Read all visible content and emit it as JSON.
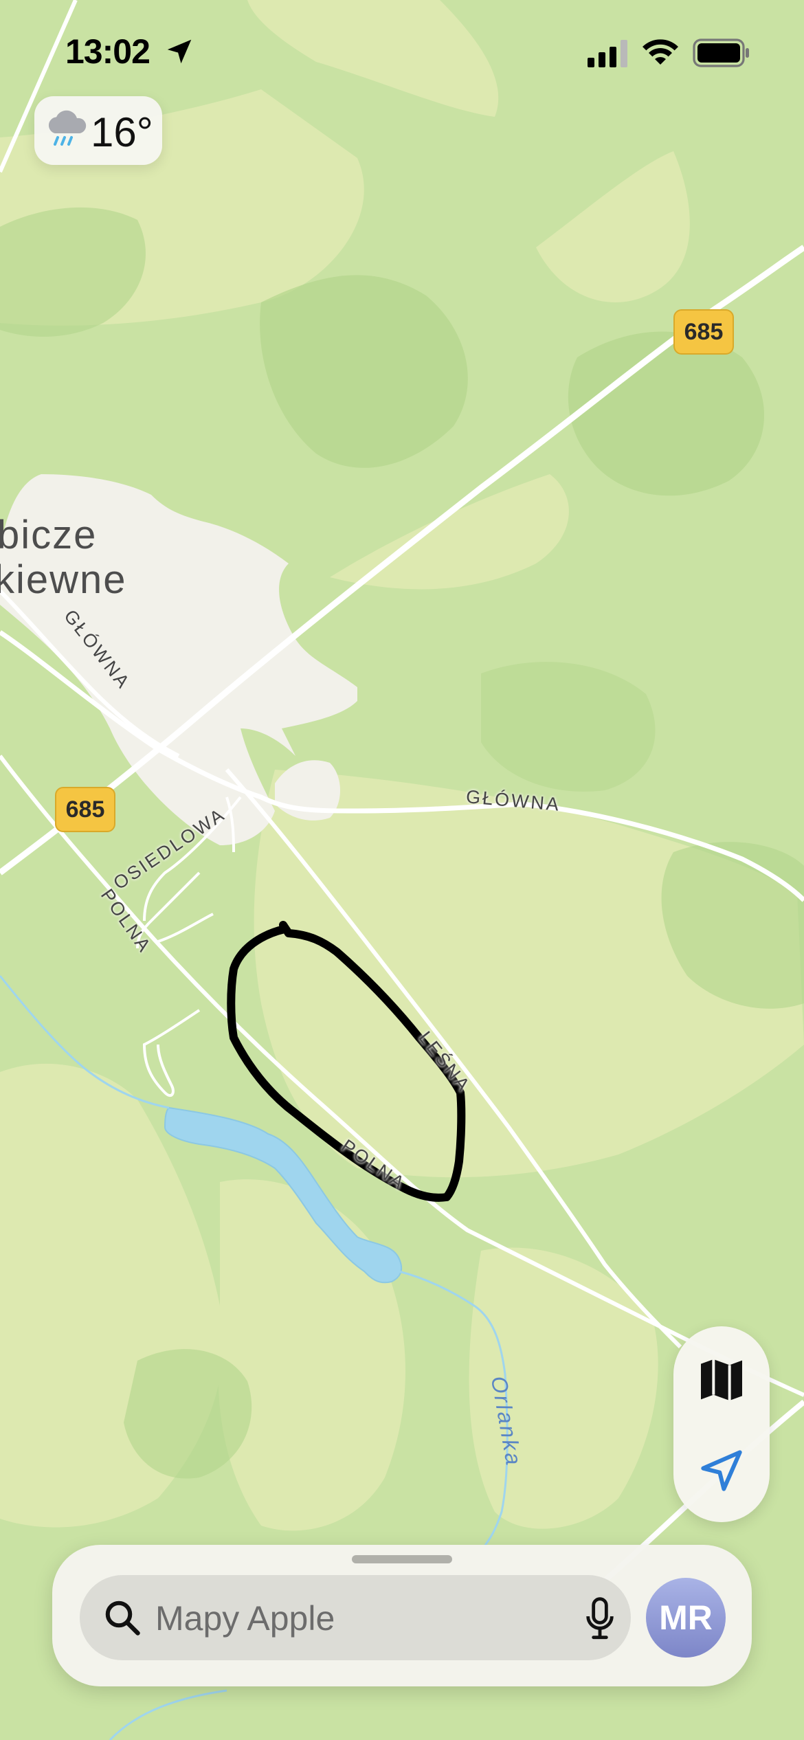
{
  "status_bar": {
    "time": "13:02",
    "location_icon": "location-arrow-icon",
    "signal_icon": "cellular-signal-icon",
    "wifi_icon": "wifi-icon",
    "battery_icon": "battery-icon"
  },
  "weather": {
    "icon": "cloud-rain-icon",
    "temperature": "16°"
  },
  "map": {
    "place_name_line1": "bicze",
    "place_name_line2": "kiewne",
    "roads": {
      "glowna_1": "GŁÓWNA",
      "glowna_2": "GŁÓWNA",
      "osiedlowa": "OSIEDLOWA",
      "polna_1": "POLNA",
      "polna_2": "POLNA",
      "lesna": "LEŚNA"
    },
    "river": "Orlanka",
    "route_shields": [
      "685",
      "685"
    ],
    "colors": {
      "land": "#c9e2a3",
      "forest": "#b3d68c",
      "meadow": "#dde9b0",
      "settlement": "#f2f1ea",
      "water": "#9fd5ee",
      "road": "#ffffff",
      "shield": "#f5c542",
      "annotation": "#000000"
    }
  },
  "controls": {
    "map_mode_icon": "map-icon",
    "track_location_icon": "location-arrow-outline-icon"
  },
  "search": {
    "placeholder": "Mapy Apple",
    "search_icon": "magnifying-glass-icon",
    "mic_icon": "microphone-icon",
    "avatar_initials": "MR"
  }
}
